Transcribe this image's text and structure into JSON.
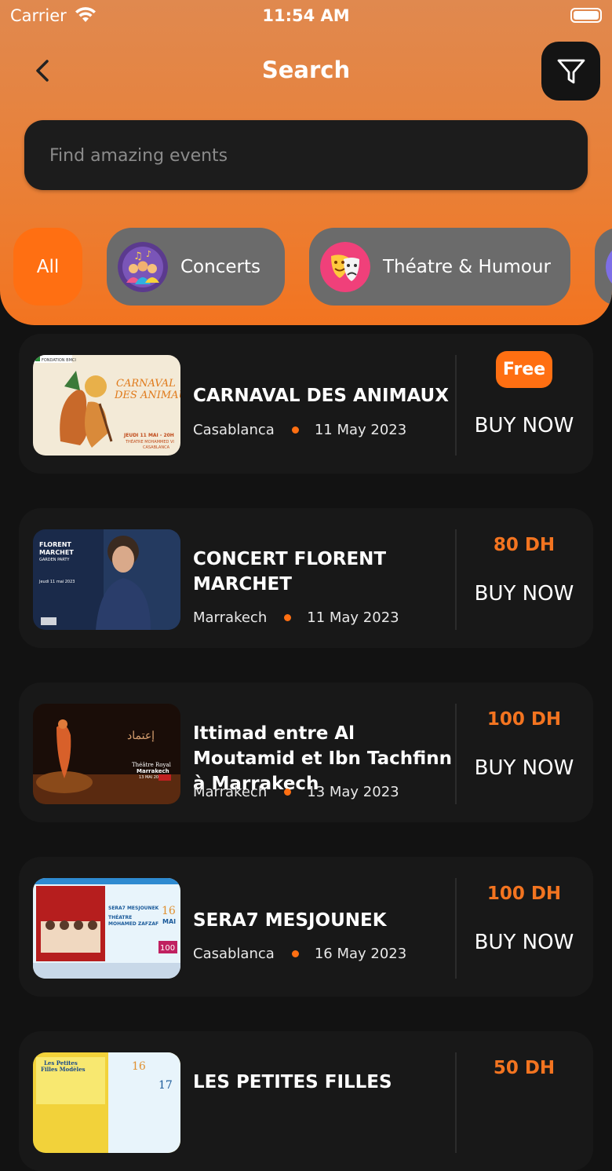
{
  "status": {
    "carrier": "Carrier",
    "time": "11:54 AM"
  },
  "header": {
    "title": "Search"
  },
  "search": {
    "placeholder": "Find amazing events"
  },
  "categories": [
    {
      "label": "All"
    },
    {
      "label": "Concerts"
    },
    {
      "label": "Théatre & Humour"
    }
  ],
  "buy_label": "BUY NOW",
  "events": [
    {
      "title": "CARNAVAL DES ANIMAUX",
      "city": "Casablanca",
      "date": "11 May 2023",
      "price": "Free"
    },
    {
      "title": "CONCERT FLORENT MARCHET",
      "city": "Marrakech",
      "date": "11 May 2023",
      "price": "80 DH"
    },
    {
      "title": "Ittimad entre Al Moutamid et Ibn Tachfinn à Marrakech",
      "city": "Marrakech",
      "date": "13 May 2023",
      "price": "100 DH"
    },
    {
      "title": "SERA7 MESJOUNEK",
      "city": "Casablanca",
      "date": "16 May 2023",
      "price": "100 DH"
    },
    {
      "title": "LES PETITES FILLES",
      "city": "",
      "date": "",
      "price": "50 DH"
    }
  ],
  "thumbnails": {
    "t1": {
      "lines": [
        "FONDATION BMCI",
        "CARNAVAL",
        "DES ANIMAUX",
        "JEUDI 11 MAI - 20H",
        "THÉATRE MOHAMMED VI",
        "CASABLANCA"
      ]
    },
    "t2": {
      "lines": [
        "FLORENT",
        "MARCHET",
        "GARDEN PARTY",
        "Jeudi 11 mai 2023"
      ]
    },
    "t3": {
      "lines": [
        "Théâtre Royal",
        "Marrakech",
        "13 MAI 2023"
      ]
    },
    "t4": {
      "lines": [
        "SERA7 MESJOUNEK",
        "THÉATRE",
        "MOHAMED ZAFZAF",
        "16",
        "MAI",
        "100"
      ]
    },
    "t5": {
      "lines": [
        "Les Petites",
        "Filles Modèles",
        "16",
        "17"
      ]
    }
  },
  "colors": {
    "accent": "#ff6f12",
    "header_top": "#e0894f",
    "header_bottom": "#f37420",
    "card": "#181818",
    "background": "#121212"
  }
}
